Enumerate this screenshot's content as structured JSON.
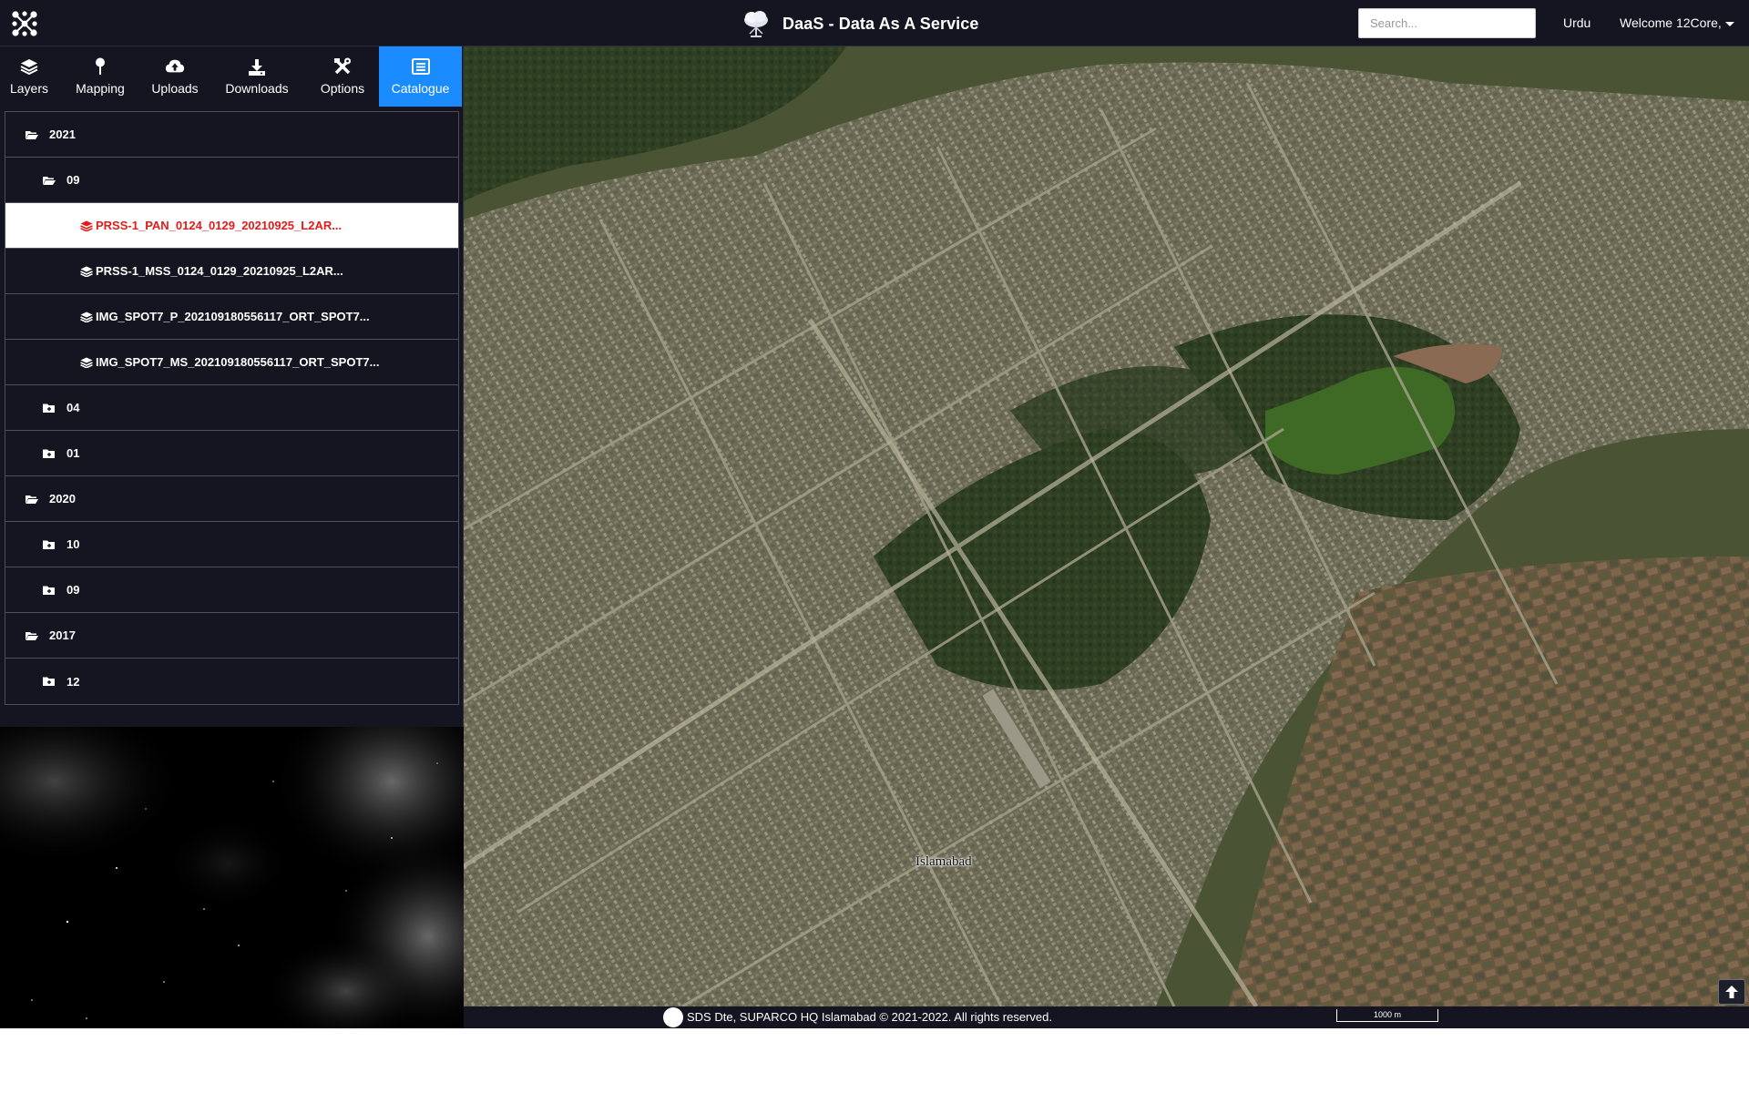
{
  "header": {
    "title": "DaaS - Data As A Service",
    "search_placeholder": "Search...",
    "language": "Urdu",
    "welcome": "Welcome 12Core,"
  },
  "tabs": [
    {
      "label": "Layers",
      "icon": "layers-icon"
    },
    {
      "label": "Mapping",
      "icon": "map-pin-icon"
    },
    {
      "label": "Uploads",
      "icon": "cloud-upload-icon"
    },
    {
      "label": "Downloads",
      "icon": "download-icon"
    },
    {
      "label": "Options",
      "icon": "tools-icon"
    },
    {
      "label": "Catalogue",
      "icon": "catalogue-icon",
      "active": true
    }
  ],
  "catalogue": [
    {
      "label": "2021",
      "level": 0,
      "type": "folder-open"
    },
    {
      "label": "09",
      "level": 1,
      "type": "folder-open"
    },
    {
      "label": "PRSS-1_PAN_0124_0129_20210925_L2AR...",
      "level": 2,
      "type": "layer",
      "selected": true
    },
    {
      "label": "PRSS-1_MSS_0124_0129_20210925_L2AR...",
      "level": 2,
      "type": "layer"
    },
    {
      "label": "IMG_SPOT7_P_202109180556117_ORT_SPOT7...",
      "level": 2,
      "type": "layer"
    },
    {
      "label": "IMG_SPOT7_MS_202109180556117_ORT_SPOT7...",
      "level": 2,
      "type": "layer"
    },
    {
      "label": "04",
      "level": 1,
      "type": "folder-closed"
    },
    {
      "label": "01",
      "level": 1,
      "type": "folder-closed"
    },
    {
      "label": "2020",
      "level": 0,
      "type": "folder-open"
    },
    {
      "label": "10",
      "level": 1,
      "type": "folder-closed"
    },
    {
      "label": "09",
      "level": 1,
      "type": "folder-closed"
    },
    {
      "label": "2017",
      "level": 0,
      "type": "folder-open"
    },
    {
      "label": "12",
      "level": 1,
      "type": "folder-closed"
    }
  ],
  "map": {
    "city_label": "Islamabad",
    "scale_label": "1000 m"
  },
  "footer": {
    "copyright": "SDS Dte, SUPARCO HQ Islamabad © 2021-2022. All rights reserved."
  },
  "colors": {
    "header_bg": "#141520",
    "active_tab": "#1a8cff",
    "selected_text": "#e31b1b"
  }
}
